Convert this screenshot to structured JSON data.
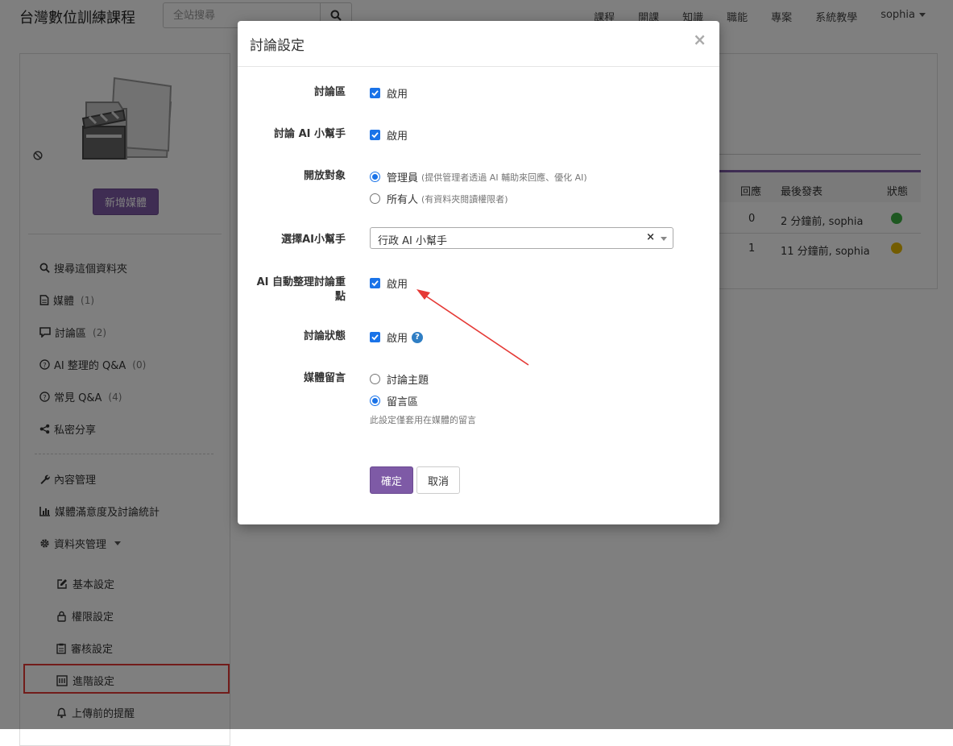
{
  "nav": {
    "brand": "台灣數位訓練課程",
    "search_placeholder": "全站搜尋",
    "links": [
      "課程",
      "開課",
      "知識",
      "職能",
      "專案",
      "系統教學"
    ],
    "user": "sophia"
  },
  "sidebar": {
    "add_media": "新增媒體",
    "items": [
      {
        "label": "搜尋這個資料夾",
        "count": "",
        "icon": "search-icon"
      },
      {
        "label": "媒體",
        "count": "(1)",
        "icon": "file-icon"
      },
      {
        "label": "討論區",
        "count": "(2)",
        "icon": "chat-icon"
      },
      {
        "label": "AI 整理的 Q&A",
        "count": "(0)",
        "icon": "question-icon"
      },
      {
        "label": "常見 Q&A",
        "count": "(4)",
        "icon": "question-icon"
      },
      {
        "label": "私密分享",
        "count": "",
        "icon": "share-icon"
      }
    ],
    "admin_items": [
      {
        "label": "內容管理",
        "icon": "wrench-icon"
      },
      {
        "label": "媒體滿意度及討論統計",
        "icon": "bar-chart-icon"
      },
      {
        "label": "資料夾管理",
        "icon": "gear-icon"
      }
    ],
    "sub_items": [
      {
        "label": "基本設定",
        "icon": "edit-icon"
      },
      {
        "label": "權限設定",
        "icon": "lock-icon"
      },
      {
        "label": "審核設定",
        "icon": "clipboard-icon"
      },
      {
        "label": "進階設定",
        "icon": "advanced-settings-icon"
      },
      {
        "label": "上傳前的提醒",
        "icon": "bell-icon"
      }
    ]
  },
  "table": {
    "headers": {
      "replies": "回應",
      "last_post": "最後發表",
      "status": "狀態"
    },
    "rows": [
      {
        "replies": "0",
        "last_post": "2 分鐘前, sophia",
        "status_color": "#3cb043"
      },
      {
        "replies": "1",
        "last_post": "11 分鐘前, sophia",
        "status_color": "#e6b800"
      }
    ]
  },
  "modal": {
    "title": "討論設定",
    "close": "×",
    "fields": {
      "discussion_label": "討論區",
      "discussion_value": "啟用",
      "ai_helper_label": "討論 AI 小幫手",
      "ai_helper_value": "啟用",
      "audience_label": "開放對象",
      "audience_opt1": "管理員",
      "audience_opt1_hint": "(提供管理者透過 AI 輔助來回應、優化 AI)",
      "audience_opt2": "所有人",
      "audience_opt2_hint": "(有資料夾閱讀權限者)",
      "select_ai_label": "選擇AI小幫手",
      "select_ai_value": "行政 AI 小幫手",
      "auto_summary_label_1": "AI 自動整理討論重",
      "auto_summary_label_2": "點",
      "auto_summary_value": "啟用",
      "status_label": "討論狀態",
      "status_value": "啟用",
      "media_comment_label": "媒體留言",
      "media_comment_opt1": "討論主題",
      "media_comment_opt2": "留言區",
      "media_comment_note": "此設定僅套用在媒體的留言"
    },
    "ok_button": "確定",
    "cancel_button": "取消"
  },
  "colors": {
    "accent": "#7e5aa6",
    "checkbox": "#1a73e8",
    "highlight": "#e53935"
  }
}
